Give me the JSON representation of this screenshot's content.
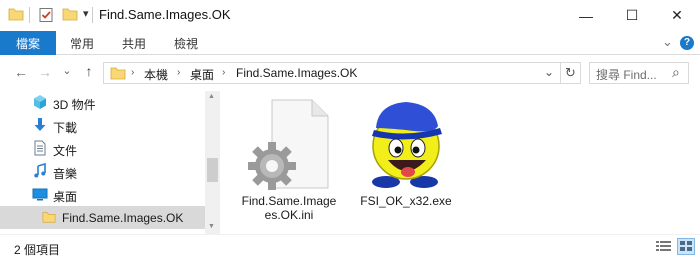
{
  "window": {
    "title": "Find.Same.Images.OK",
    "minimize_glyph": "—",
    "maximize_glyph": "☐",
    "close_glyph": "✕",
    "quick_access_dropdown": "▾"
  },
  "ribbon": {
    "tabs": [
      {
        "label": "檔案",
        "active": true
      },
      {
        "label": "常用"
      },
      {
        "label": "共用"
      },
      {
        "label": "檢視"
      }
    ],
    "collapse_glyph": "⌄",
    "help_glyph": "?"
  },
  "address": {
    "back_glyph": "←",
    "forward_glyph": "→",
    "recent_glyph": "⌄",
    "up_glyph": "↑",
    "crumbs": [
      "本機",
      "桌面",
      "Find.Same.Images.OK"
    ],
    "separator": "›",
    "dropdown_glyph": "⌄",
    "refresh_glyph": "↻",
    "search_placeholder": "搜尋 Find...",
    "search_icon_glyph": "⌕"
  },
  "nav": {
    "items": [
      {
        "label": "3D 物件",
        "icon": "cube-icon"
      },
      {
        "label": "下載",
        "icon": "download-icon"
      },
      {
        "label": "文件",
        "icon": "document-icon"
      },
      {
        "label": "音樂",
        "icon": "music-icon"
      },
      {
        "label": "桌面",
        "icon": "desktop-icon"
      },
      {
        "label": "Find.Same.Images.OK",
        "icon": "folder-icon",
        "selected": true
      }
    ]
  },
  "files": [
    {
      "name_line1": "Find.Same.Image",
      "name_line2": "es.OK.ini",
      "icon": "settings-file-icon"
    },
    {
      "name_line1": "FSI_OK_x32.exe",
      "icon": "smiley-app-icon"
    }
  ],
  "status": {
    "text": "2 個項目"
  },
  "colors": {
    "accent": "#1979ca",
    "folder": "#f8d775",
    "selected_bg": "#d9d9d9"
  }
}
